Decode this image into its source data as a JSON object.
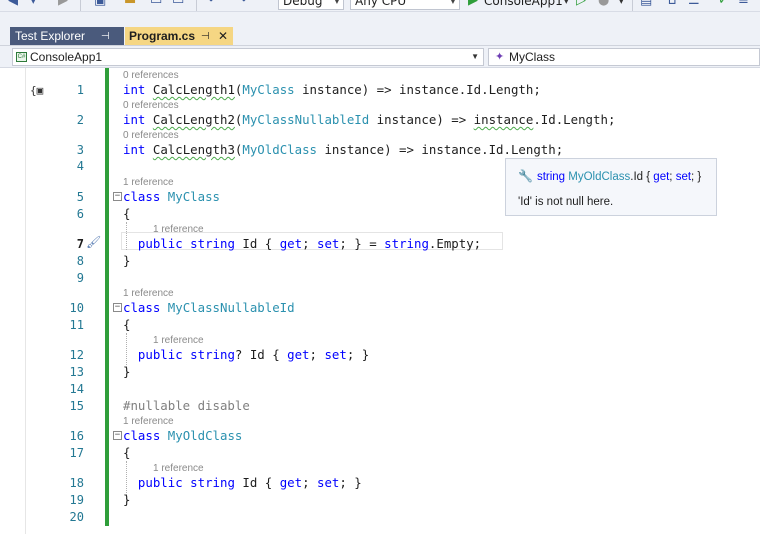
{
  "toolbar": {
    "configuration": "Debug",
    "platform": "Any CPU",
    "start_target": "ConsoleApp1"
  },
  "tabs": [
    {
      "label": "Test Explorer",
      "active": false
    },
    {
      "label": "Program.cs",
      "active": true
    }
  ],
  "navbar": {
    "project": "ConsoleApp1",
    "type_member": "MyClass"
  },
  "editor": {
    "current_line": "7",
    "line_numbers": [
      "1",
      "2",
      "3",
      "4",
      "5",
      "6",
      "7",
      "8",
      "9",
      "10",
      "11",
      "12",
      "13",
      "14",
      "15",
      "16",
      "17",
      "18",
      "19",
      "20"
    ],
    "refs": {
      "r1": "0 references",
      "r2": "0 references",
      "r3": "0 references",
      "r5": "1 reference",
      "r7": "1 reference",
      "r10": "1 reference",
      "r12": "1 reference",
      "r16": "1 reference",
      "r18": "1 reference"
    },
    "code": {
      "l1": {
        "kw": "int",
        "name": "CalcLength1",
        "p1": "(",
        "type": "MyClass",
        "rest": " instance) => instance.Id.Length;"
      },
      "l2": {
        "kw": "int",
        "name": "CalcLength2",
        "p1": "(",
        "type": "MyClassNullableId",
        "rest1": " instance) => ",
        "sq": "instance",
        "rest2": ".Id.Length;"
      },
      "l3": {
        "kw": "int",
        "name": "CalcLength3",
        "p1": "(",
        "type": "MyOldClass",
        "rest": " instance) => instance.Id.Length;"
      },
      "l5": {
        "kw": "class",
        "type": "MyClass"
      },
      "l6": "{",
      "l7": {
        "kw1": "public",
        "kw2": "string",
        "a": " Id { ",
        "kw3": "get",
        "b": "; ",
        "kw4": "set",
        "c": "; } = ",
        "kw5": "string",
        "d": ".Empty;"
      },
      "l8": "}",
      "l10": {
        "kw": "class",
        "type": "MyClassNullableId"
      },
      "l11": "{",
      "l12": {
        "kw1": "public",
        "kw2": "string",
        "a": "? Id { ",
        "kw3": "get",
        "b": "; ",
        "kw4": "set",
        "c": "; }"
      },
      "l13": "}",
      "l15": "#nullable disable",
      "l16": {
        "kw": "class",
        "type": "MyOldClass"
      },
      "l17": "{",
      "l18": {
        "kw1": "public",
        "kw2": "string",
        "a": " Id { ",
        "kw3": "get",
        "b": "; ",
        "kw4": "set",
        "c": "; }"
      },
      "l19": "}"
    }
  },
  "tooltip": {
    "kw": "string",
    "type": "MyOldClass",
    "member": ".Id { ",
    "get": "get",
    "sep": "; ",
    "set": "set",
    "end": "; }",
    "message": "'Id' is not null here."
  },
  "colors": {
    "keyword": "#0000ff",
    "type": "#2b91af",
    "line_number": "#237893",
    "change_bar": "#2f9e3a",
    "active_tab": "#f5d683",
    "inactive_tab": "#4a5a7c"
  }
}
